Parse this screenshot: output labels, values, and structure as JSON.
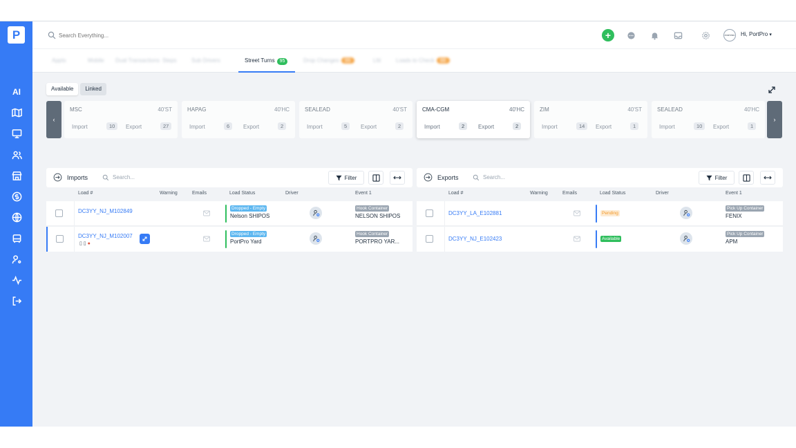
{
  "sidebar": {
    "logo": "P",
    "ai_label": "AI",
    "icons": [
      "map-icon",
      "monitor-icon",
      "users-icon",
      "store-icon",
      "dollar-icon",
      "globe-icon",
      "bus-icon",
      "user-settings-icon",
      "activity-icon",
      "logout-icon"
    ]
  },
  "topbar": {
    "search_placeholder": "Search Everything...",
    "add": "+",
    "avatar_text": "PORTPRO",
    "greeting_prefix": "Hi,",
    "user_name": "PortPro",
    "caret": "▾"
  },
  "tabs": {
    "blurred": [
      {
        "label": "Appts",
        "pill": ""
      },
      {
        "label": "Mobile",
        "pill": ""
      },
      {
        "label": "Dual Transactions",
        "pill": ""
      },
      {
        "label": "Steps",
        "pill": ""
      },
      {
        "label": "Sub Drivers",
        "pill": ""
      }
    ],
    "active": {
      "label": "Street Turns",
      "count": "95"
    },
    "blurred_after": [
      {
        "label": "Drop Changes",
        "pill": "99"
      },
      {
        "label": "Lfd",
        "pill": ""
      },
      {
        "label": "Loads to Check",
        "pill": "88"
      }
    ]
  },
  "segmented": {
    "available": "Available",
    "linked": "Linked"
  },
  "carousel": {
    "prev": "‹",
    "next": "›",
    "cards": [
      {
        "name": "MSC",
        "size": "40'ST",
        "import_label": "Import",
        "import": "10",
        "export_label": "Export",
        "export": "27"
      },
      {
        "name": "HAPAG",
        "size": "40'HC",
        "import_label": "Import",
        "import": "6",
        "export_label": "Export",
        "export": "2"
      },
      {
        "name": "SEALEAD",
        "size": "40'ST",
        "import_label": "Import",
        "import": "5",
        "export_label": "Export",
        "export": "2"
      },
      {
        "name": "CMA-CGM",
        "size": "40'HC",
        "import_label": "Import",
        "import": "2",
        "export_label": "Export",
        "export": "2"
      },
      {
        "name": "ZIM",
        "size": "40'ST",
        "import_label": "Import",
        "import": "14",
        "export_label": "Export",
        "export": "1"
      },
      {
        "name": "SEALEAD",
        "size": "40'HC",
        "import_label": "Import",
        "import": "10",
        "export_label": "Export",
        "export": "1"
      }
    ]
  },
  "imports": {
    "title": "Imports",
    "search_placeholder": "Search...",
    "filter": "Filter",
    "columns": [
      "Load #",
      "Warning",
      "Emails",
      "Load Status",
      "Driver",
      "Event 1"
    ],
    "rows": [
      {
        "load": "DC3YY_NJ_M102849",
        "status_tag": "Dropped - Empty",
        "status_text": "Nelson SHIPOS",
        "event_tag": "Hook Container",
        "event_text": "NELSON SHIPOS"
      },
      {
        "load": "DC3YY_NJ_M102007",
        "status_tag": "Dropped - Empty",
        "status_text": "PortPro Yard",
        "event_tag": "Hook Container",
        "event_text": "PORTPRO YAR..."
      }
    ]
  },
  "exports": {
    "title": "Exports",
    "search_placeholder": "Search...",
    "filter": "Filter",
    "columns": [
      "Load #",
      "Warning",
      "Emails",
      "Load Status",
      "Driver",
      "Event 1"
    ],
    "rows": [
      {
        "load": "DC3YY_LA_E102881",
        "status_tag": "Pending",
        "event_tag": "Pick Up Container",
        "event_text": "FENIX"
      },
      {
        "load": "DC3YY_NJ_E102423",
        "status_tag": "Available",
        "event_tag": "Pick Up Container",
        "event_text": "APM"
      }
    ]
  },
  "colors": {
    "brand": "#367bf5",
    "success": "#2fbe5d",
    "pending": "#f39a2b",
    "dropped": "#5db7f0"
  }
}
